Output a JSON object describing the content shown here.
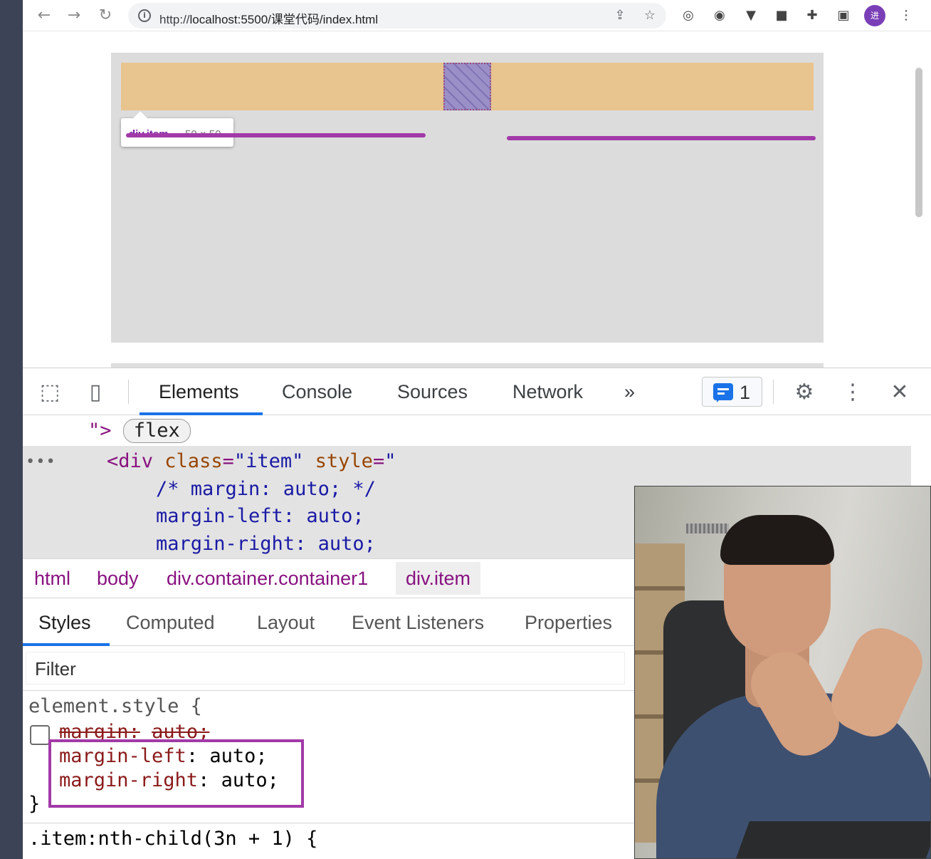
{
  "browser": {
    "url_prefix": "http://",
    "url_host": "localhost:5500/课堂代码/index.html",
    "avatar_text": "进",
    "icons": {
      "back": "back-arrow-icon",
      "forward": "forward-arrow-icon",
      "reload": "reload-icon",
      "info": "info-icon",
      "share": "share-icon",
      "bookmark": "star-icon",
      "extensions": [
        "camera-extension-icon",
        "password-extension-icon",
        "vue-extension-icon",
        "ghost-extension-icon",
        "puzzle-icon",
        "sidepanel-icon"
      ],
      "menu": "kebab-menu-icon"
    }
  },
  "page": {
    "tooltip": {
      "tag": "div.item",
      "dims": "50 × 50"
    },
    "colors": {
      "container": "#dcdcdc",
      "row": "#e8c48e",
      "item": "#9b8fc8",
      "annotation": "#a23aa8"
    }
  },
  "devtools": {
    "tabs": [
      "Elements",
      "Console",
      "Sources",
      "Network"
    ],
    "more_tabs": "»",
    "issues_count": "1",
    "dom": {
      "line1_prefix": "\">",
      "line1_badge": "flex",
      "ellipsis": "•••",
      "line2_open": "<div",
      "line2_attr1": "class",
      "line2_val1": "\"item\"",
      "line2_attr2": "style",
      "line2_val2": "\"",
      "line3": "/* margin: auto; */",
      "line4": "margin-left: auto;",
      "line5": "margin-right: auto;"
    },
    "breadcrumbs": [
      "html",
      "body",
      "div.container.container1",
      "div.item"
    ],
    "subtabs": [
      "Styles",
      "Computed",
      "Layout",
      "Event Listeners",
      "Properties"
    ],
    "filter_placeholder": "Filter",
    "styles": {
      "selector": "element.style {",
      "struck_prop": "margin",
      "struck_sep": ":",
      "struck_value": "auto;",
      "prop1": "margin-left",
      "val1": "auto;",
      "prop2": "margin-right",
      "val2": "auto;",
      "close": "}",
      "next_selector": ".item:nth-child(3n + 1) {"
    }
  }
}
